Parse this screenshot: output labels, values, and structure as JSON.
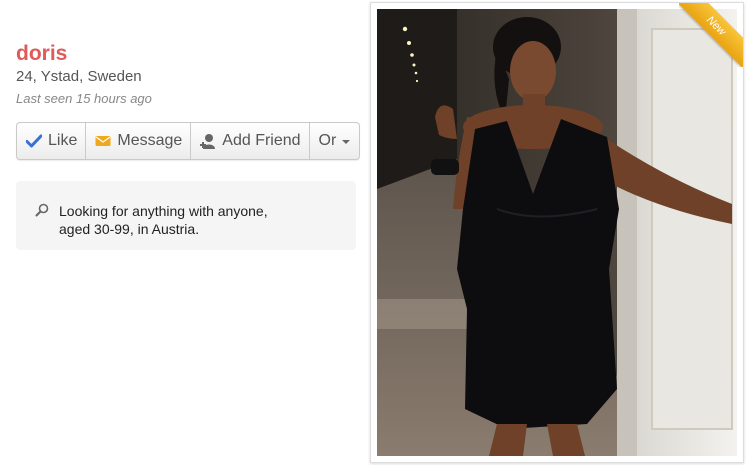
{
  "profile": {
    "name": "doris",
    "location": "24, Ystad, Sweden",
    "last_seen": "Last seen 15 hours ago"
  },
  "actions": {
    "like": "Like",
    "message": "Message",
    "add_friend": "Add Friend",
    "or": "Or"
  },
  "looking_for": {
    "line1": "Looking for anything with anyone,",
    "line2": "aged 30-99, in Austria."
  },
  "photo": {
    "badge": "New"
  },
  "colors": {
    "name": "#e05a5a",
    "like_check": "#3b6fd4",
    "message_icon": "#f0a81c",
    "badge": "#f2b525"
  },
  "icons": [
    "check-icon",
    "envelope-icon",
    "add-person-icon",
    "caret-down-icon",
    "search-icon"
  ]
}
